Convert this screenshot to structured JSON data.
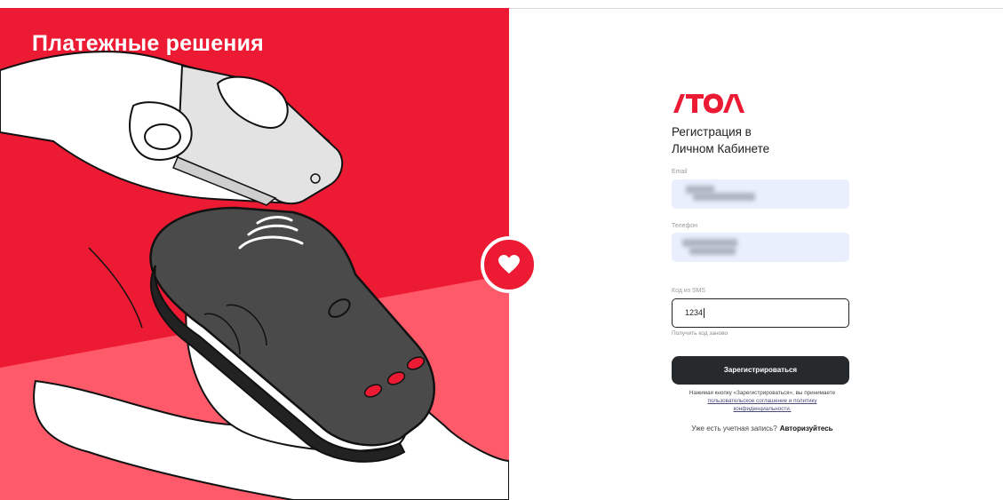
{
  "hero": {
    "title": "Платежные решения",
    "heart_icon": "heart-icon",
    "colors": {
      "red": "#ec1b33",
      "pink": "#ff5a6a",
      "white": "#ffffff",
      "terminal": "#4a4a4a"
    }
  },
  "brand": {
    "logo_text": "ATOL",
    "logo_color": "#ec1b33"
  },
  "form": {
    "title_line1": "Регистрация в",
    "title_line2": "Личном Кабинете",
    "email": {
      "label": "Email",
      "value": ""
    },
    "phone": {
      "label": "Телефон",
      "value": ""
    },
    "sms": {
      "label": "Код из SMS",
      "value": "1234"
    },
    "resend_label": "Получить код заново",
    "submit_label": "Зарегистрироваться",
    "agreement_text": "Нажимая кнопку «Зарегистрироваться», вы принимаете",
    "agreement_link_1": "пользовательское соглашение и политику",
    "agreement_link_2": "конфиденциальности.",
    "login_prompt": "Уже есть учетная запись?",
    "login_link": "Авторизуйтесь"
  }
}
